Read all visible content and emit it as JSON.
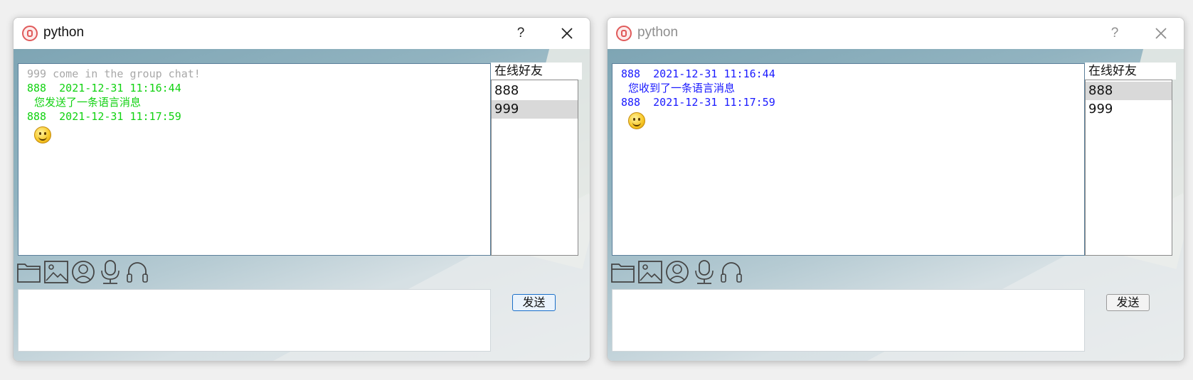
{
  "windows": [
    {
      "title": "python",
      "help_label": "?",
      "friends_label": "在线好友",
      "friends": [
        {
          "name": "888",
          "selected": false
        },
        {
          "name": "999",
          "selected": true
        }
      ],
      "messages": {
        "system": "999 come in the group chat!",
        "m1_header": "888  2021-12-31 11:16:44",
        "m1_body": "您发送了一条语言消息",
        "m2_header": "888  2021-12-31 11:17:59"
      },
      "send_label": "发送",
      "input_value": ""
    },
    {
      "title": "python",
      "help_label": "?",
      "friends_label": "在线好友",
      "friends": [
        {
          "name": "888",
          "selected": true
        },
        {
          "name": "999",
          "selected": false
        }
      ],
      "messages": {
        "m1_header": "888  2021-12-31 11:16:44",
        "m1_body": "您收到了一条语言消息",
        "m2_header": "888  2021-12-31 11:17:59"
      },
      "send_label": "发送",
      "input_value": ""
    }
  ],
  "toolbar_icons": [
    "folder-icon",
    "image-icon",
    "video-chat-icon",
    "microphone-icon",
    "headset-icon"
  ],
  "colors": {
    "sent_message": "#11d211",
    "received_message": "#1a1aff",
    "system_message": "#a8a8a8"
  }
}
